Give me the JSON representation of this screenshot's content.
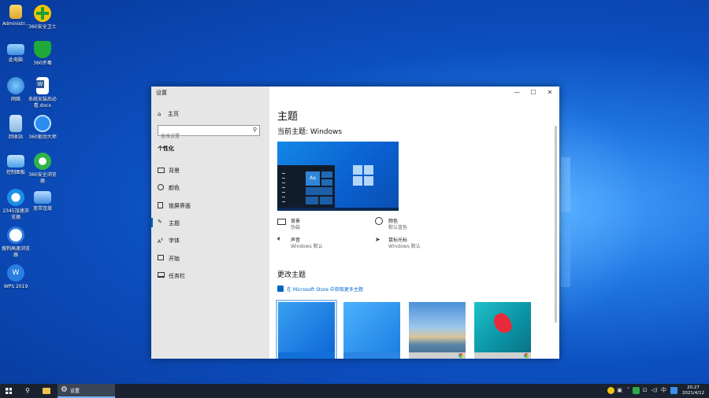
{
  "desktop": {
    "icons": [
      {
        "label": "Administr...",
        "icon": "user-folder-icon"
      },
      {
        "label": "360安全卫士",
        "icon": "360-security-icon"
      },
      {
        "label": "此电脑",
        "icon": "computer-icon"
      },
      {
        "label": "360杀毒",
        "icon": "360-antivirus-icon"
      },
      {
        "label": "网络",
        "icon": "network-icon"
      },
      {
        "label": "系统安装后必看.docx",
        "icon": "word-document-icon"
      },
      {
        "label": "回收站",
        "icon": "recycle-bin-icon"
      },
      {
        "label": "360驱动大师",
        "icon": "360-driver-icon"
      },
      {
        "label": "控制面板",
        "icon": "control-panel-icon"
      },
      {
        "label": "360安全浏览器",
        "icon": "360-browser-icon"
      },
      {
        "label": "2345加速浏览器",
        "icon": "2345-browser-icon"
      },
      {
        "label": "宽带连接",
        "icon": "broadband-icon"
      },
      {
        "label": "搜狗高速浏览器",
        "icon": "sogou-browser-icon"
      },
      {
        "label": "WPS 2019",
        "icon": "wps-icon"
      }
    ]
  },
  "window": {
    "title": "设置",
    "controls": {
      "minimize": "—",
      "maximize": "☐",
      "close": "✕"
    }
  },
  "sidebar": {
    "home": "主页",
    "search_placeholder": "查找设置",
    "section": "个性化",
    "items": [
      {
        "label": "背景",
        "icon": "image-icon"
      },
      {
        "label": "颜色",
        "icon": "palette-icon"
      },
      {
        "label": "锁屏界面",
        "icon": "lock-screen-icon"
      },
      {
        "label": "主题",
        "icon": "brush-icon",
        "active": true
      },
      {
        "label": "字体",
        "icon": "font-icon"
      },
      {
        "label": "开始",
        "icon": "start-icon"
      },
      {
        "label": "任务栏",
        "icon": "taskbar-icon"
      }
    ]
  },
  "main": {
    "title": "主题",
    "current_theme": "当前主题: Windows",
    "preview_tile_text": "Aa",
    "properties": {
      "background": {
        "title": "背景",
        "value": "伪装"
      },
      "color": {
        "title": "颜色",
        "value": "默认蓝色"
      },
      "sound": {
        "title": "声音",
        "value": "Windows 默认"
      },
      "cursor": {
        "title": "鼠标光标",
        "value": "Windows 默认"
      }
    },
    "change_theme": "更改主题",
    "store_link": "在 Microsoft Store 中获取更多主题"
  },
  "taskbar": {
    "open_app": "设置",
    "time": "20:27",
    "date": "2021/4/12",
    "tray_text": "中"
  },
  "colors": {
    "accent": "#0067c0",
    "sidebar_bg": "#e6e6e6",
    "taskbar_bg": "#1a2230"
  }
}
